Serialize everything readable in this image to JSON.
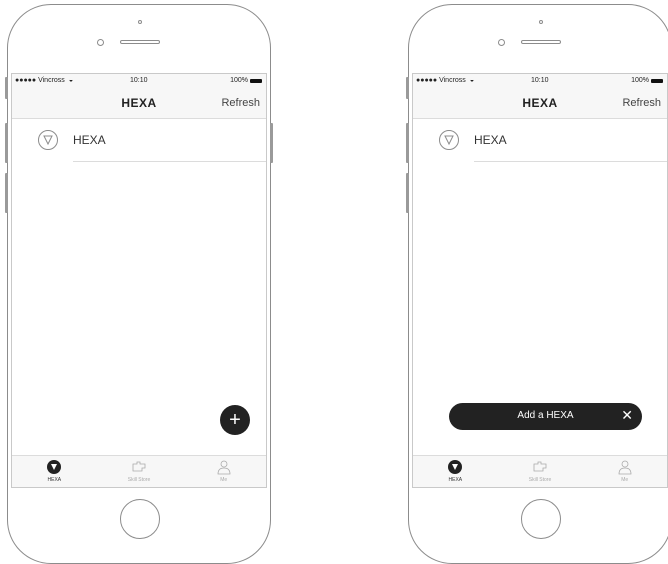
{
  "phones": [
    {
      "status": {
        "carrier": "●●●●● Vincross",
        "time": "10:10",
        "battery": "100%"
      },
      "nav": {
        "title": "HEXA",
        "refresh": "Refresh"
      },
      "list": [
        {
          "label": "HEXA"
        }
      ],
      "fab_label": "+",
      "tabs": [
        {
          "label": "HEXA",
          "icon": "hexa-icon"
        },
        {
          "label": "Skill Store",
          "icon": "puzzle-icon"
        },
        {
          "label": "Me",
          "icon": "person-icon"
        }
      ]
    },
    {
      "status": {
        "carrier": "●●●●● Vincross",
        "time": "10:10",
        "battery": "100%"
      },
      "nav": {
        "title": "HEXA",
        "refresh": "Refresh"
      },
      "list": [
        {
          "label": "HEXA"
        }
      ],
      "toast": {
        "label": "Add a HEXA",
        "close": "✕"
      },
      "tabs": [
        {
          "label": "HEXA",
          "icon": "hexa-icon"
        },
        {
          "label": "Skill Store",
          "icon": "puzzle-icon"
        },
        {
          "label": "Me",
          "icon": "person-icon"
        }
      ]
    }
  ],
  "colors": {
    "dark": "#222222",
    "frame": "#8c8c8c",
    "bar": "#f7f7f7",
    "inactive": "#aaaaaa"
  }
}
